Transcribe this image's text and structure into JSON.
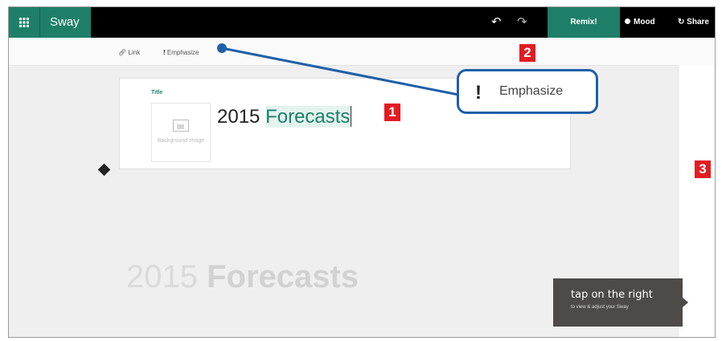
{
  "app": {
    "name": "Sway"
  },
  "topbar": {
    "undo_icon": "undo-icon",
    "redo_icon": "redo-icon",
    "remix_label": "Remix!",
    "mood_label": "Mood",
    "share_label": "Share"
  },
  "toolbar": {
    "link_label": "Link",
    "emphasize_label": "Emphasize"
  },
  "card": {
    "label": "Title",
    "bg_image_text": "Background image",
    "title_plain": "2015 ",
    "title_highlight": "Forecasts"
  },
  "preview": {
    "plain": "2015 ",
    "bold": "Forecasts"
  },
  "hint": {
    "line1": "tap on the right",
    "line2": "to view & adjust your Sway"
  },
  "callout": {
    "label": "Emphasize",
    "icon": "!"
  },
  "markers": {
    "m1": "1",
    "m2": "2",
    "m3": "3"
  },
  "colors": {
    "accent": "#1e7f68",
    "callout_border": "#1f5fa8",
    "marker": "#e31b23"
  }
}
